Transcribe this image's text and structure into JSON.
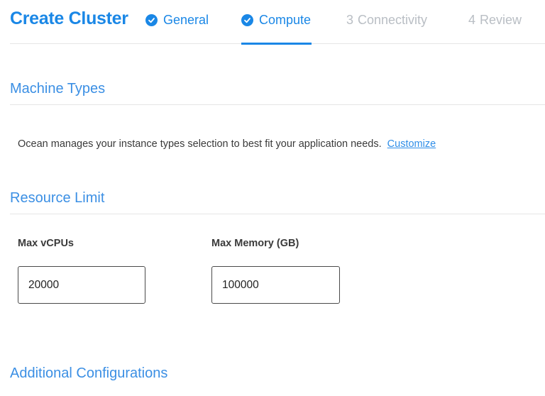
{
  "header": {
    "title": "Create Cluster",
    "steps": [
      {
        "label": "General",
        "state": "done"
      },
      {
        "label": "Compute",
        "state": "active"
      },
      {
        "number": "3",
        "label": "Connectivity",
        "state": "todo"
      },
      {
        "number": "4",
        "label": "Review",
        "state": "todo"
      }
    ]
  },
  "machine_types": {
    "title": "Machine Types",
    "description": "Ocean manages your instance types selection to best fit your application needs.",
    "customize_link": "Customize"
  },
  "resource_limit": {
    "title": "Resource Limit",
    "max_vcpus": {
      "label": "Max vCPUs",
      "value": "20000"
    },
    "max_memory": {
      "label": "Max Memory (GB)",
      "value": "100000"
    }
  },
  "additional": {
    "title": "Additional Configurations"
  },
  "colors": {
    "accent": "#1a87e6",
    "inactive_step": "#b9bec4",
    "divider": "#e6e6e6"
  },
  "icons": {
    "completed_step": "check-circle-icon"
  }
}
